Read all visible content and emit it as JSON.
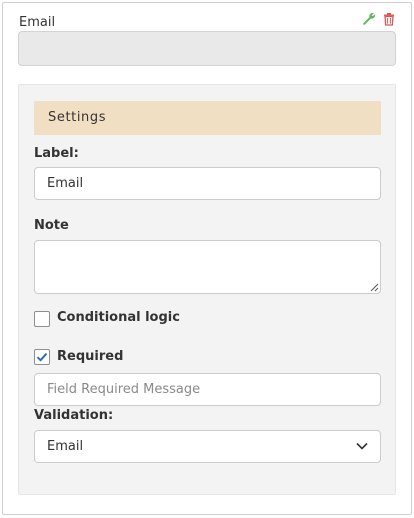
{
  "field": {
    "label": "Email",
    "tools": {
      "edit_icon": "wrench-icon",
      "delete_icon": "trash-icon"
    }
  },
  "settings": {
    "title": "Settings",
    "label_field": {
      "label": "Label:",
      "value": "Email"
    },
    "note_field": {
      "label": "Note",
      "value": ""
    },
    "conditional_logic": {
      "label": "Conditional logic",
      "checked": false
    },
    "required": {
      "label": "Required",
      "checked": true,
      "message_placeholder": "Field Required Message"
    },
    "validation": {
      "label": "Validation:",
      "selected": "Email"
    }
  },
  "colors": {
    "header_bg": "#f1dfc4",
    "panel_bg": "#f3f3f3",
    "wrench": "#5cb85c",
    "trash": "#e05555",
    "check": "#2a72b5"
  }
}
